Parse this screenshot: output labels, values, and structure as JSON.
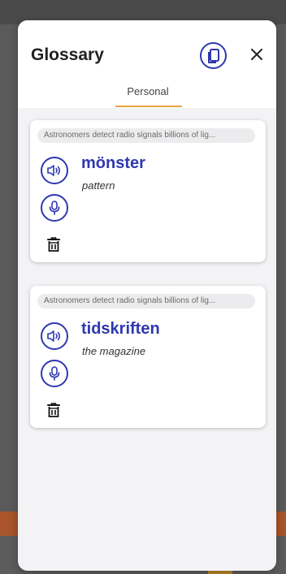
{
  "glossary": {
    "title": "Glossary",
    "close_label": "×",
    "tabs": [
      {
        "label": "Personal",
        "active": true
      }
    ],
    "entries": [
      {
        "sentence": "Astronomers detect radio signals billions of lig...",
        "word": "mönster",
        "translation": "pattern"
      },
      {
        "sentence": "Astronomers detect radio signals billions of lig...",
        "word": "tidskriften",
        "translation": "the magazine"
      }
    ]
  },
  "colors": {
    "accent": "#2f38b0",
    "tab_underline": "#e8a43c",
    "background_overlay": "#5a5a5a",
    "modal_bg": "#f3f3f6"
  },
  "icons": {
    "flashcards": "flashcards-icon",
    "close": "close-icon",
    "speaker": "speaker-icon",
    "mic": "microphone-icon",
    "trash": "trash-icon"
  }
}
